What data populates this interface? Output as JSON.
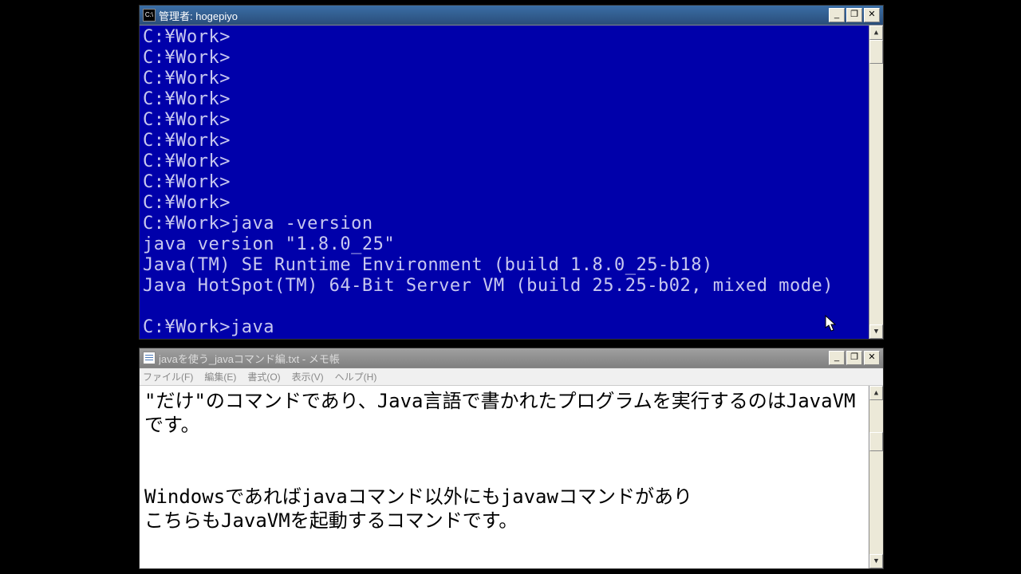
{
  "console": {
    "title": "管理者: hogepiyo",
    "lines": [
      "C:¥Work>",
      "C:¥Work>",
      "C:¥Work>",
      "C:¥Work>",
      "C:¥Work>",
      "C:¥Work>",
      "C:¥Work>",
      "C:¥Work>",
      "C:¥Work>",
      "C:¥Work>java -version",
      "java version \"1.8.0_25\"",
      "Java(TM) SE Runtime Environment (build 1.8.0_25-b18)",
      "Java HotSpot(TM) 64-Bit Server VM (build 25.25-b02, mixed mode)",
      "",
      "C:¥Work>java"
    ],
    "buttons": {
      "min": "_",
      "max": "❐",
      "close": "✕"
    },
    "scroll": {
      "up": "▲",
      "down": "▼"
    }
  },
  "notepad": {
    "title": "javaを使う_javaコマンド編.txt - メモ帳",
    "menu": {
      "file": "ファイル(F)",
      "edit": "編集(E)",
      "format": "書式(O)",
      "view": "表示(V)",
      "help": "ヘルプ(H)"
    },
    "body": "\"だけ\"のコマンドであり、Java言語で書かれたプログラムを実行するのはJavaVMです。\n\n\nWindowsであればjavaコマンド以外にもjavawコマンドがあり\nこちらもJavaVMを起動するコマンドです。",
    "buttons": {
      "min": "_",
      "max": "❐",
      "close": "✕"
    },
    "scroll": {
      "up": "▲",
      "down": "▼"
    }
  }
}
